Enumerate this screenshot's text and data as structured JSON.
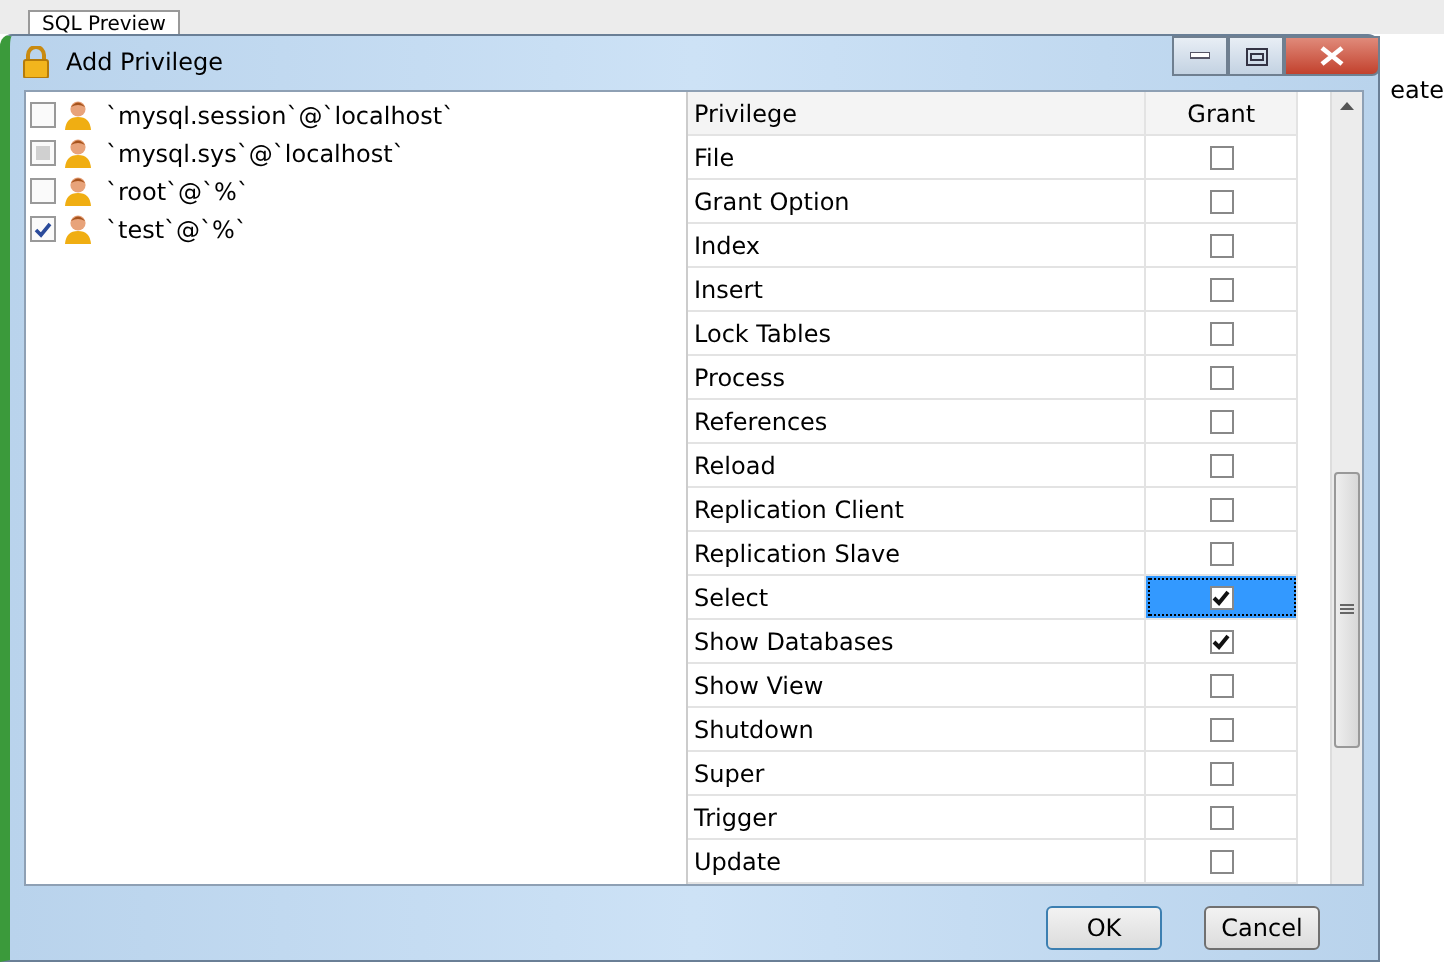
{
  "background": {
    "tab": "SQL Preview",
    "edge_text": "eate"
  },
  "window": {
    "title": "Add Privilege"
  },
  "users": [
    {
      "label": "`mysql.session`@`localhost`",
      "checked": false,
      "partial": false
    },
    {
      "label": "`mysql.sys`@`localhost`",
      "checked": false,
      "partial": true
    },
    {
      "label": "`root`@`%`",
      "checked": false,
      "partial": false
    },
    {
      "label": "`test`@`%`",
      "checked": true,
      "partial": false
    }
  ],
  "grid": {
    "columns": [
      "Privilege",
      "Grant"
    ],
    "rows": [
      {
        "privilege": "File",
        "grant": false,
        "selected": false
      },
      {
        "privilege": "Grant Option",
        "grant": false,
        "selected": false
      },
      {
        "privilege": "Index",
        "grant": false,
        "selected": false
      },
      {
        "privilege": "Insert",
        "grant": false,
        "selected": false
      },
      {
        "privilege": "Lock Tables",
        "grant": false,
        "selected": false
      },
      {
        "privilege": "Process",
        "grant": false,
        "selected": false
      },
      {
        "privilege": "References",
        "grant": false,
        "selected": false
      },
      {
        "privilege": "Reload",
        "grant": false,
        "selected": false
      },
      {
        "privilege": "Replication Client",
        "grant": false,
        "selected": false
      },
      {
        "privilege": "Replication Slave",
        "grant": false,
        "selected": false
      },
      {
        "privilege": "Select",
        "grant": true,
        "selected": true
      },
      {
        "privilege": "Show Databases",
        "grant": true,
        "selected": false
      },
      {
        "privilege": "Show View",
        "grant": false,
        "selected": false
      },
      {
        "privilege": "Shutdown",
        "grant": false,
        "selected": false
      },
      {
        "privilege": "Super",
        "grant": false,
        "selected": false
      },
      {
        "privilege": "Trigger",
        "grant": false,
        "selected": false
      },
      {
        "privilege": "Update",
        "grant": false,
        "selected": false
      }
    ]
  },
  "buttons": [
    "OK",
    "Cancel"
  ]
}
